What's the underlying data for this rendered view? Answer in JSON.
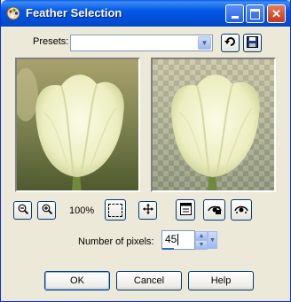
{
  "window": {
    "title": "Feather Selection"
  },
  "presets": {
    "label": "Presets:",
    "value": ""
  },
  "preview": {
    "zoom": "100%"
  },
  "pixels": {
    "label": "Number of pixels:",
    "value": "45"
  },
  "buttons": {
    "ok": "OK",
    "cancel": "Cancel",
    "help": "Help"
  },
  "icons": {
    "app": "paint-palette-icon",
    "minimize": "minimize-icon",
    "maximize": "maximize-icon",
    "close": "close-icon",
    "dropdown": "chevron-down-icon",
    "reset": "reset-arrow-icon",
    "save": "floppy-disk-icon",
    "zoom_out": "zoom-out-icon",
    "zoom_in": "zoom-in-icon",
    "marquee": "selection-marquee-icon",
    "move": "move-icon",
    "proof": "proof-window-icon",
    "auto_proof": "auto-proof-lock-icon",
    "randomize": "randomize-icon"
  },
  "colors": {
    "title_bar": "#0054e3",
    "dialog_bg": "#ece9d8",
    "button_border": "#003c74"
  }
}
